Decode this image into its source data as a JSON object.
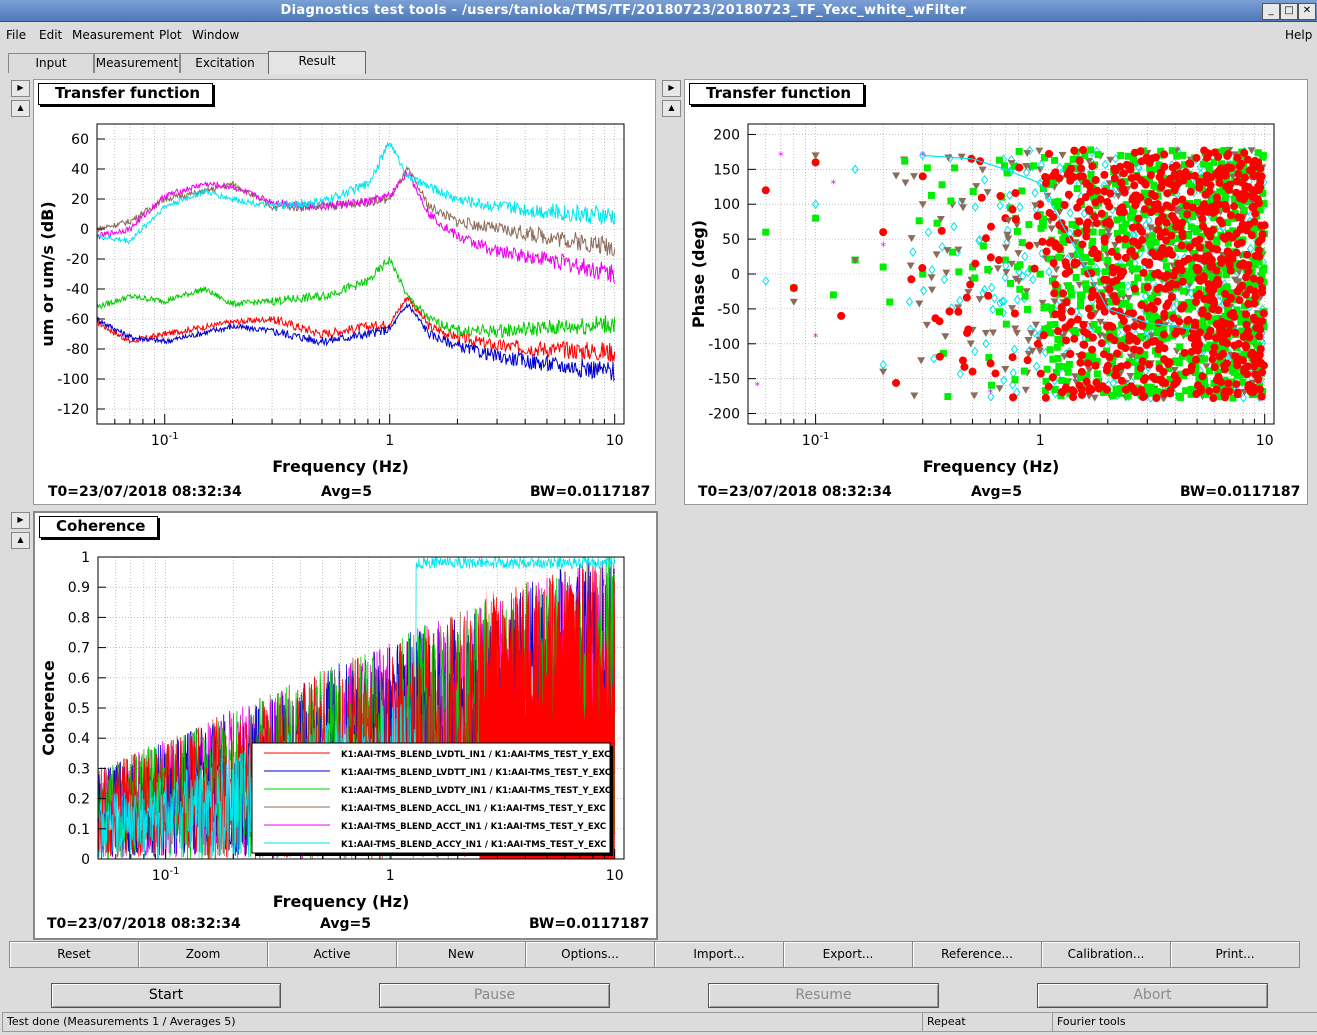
{
  "window": {
    "title": "Diagnostics test tools - /users/tanioka/TMS/TF/20180723/20180723_TF_Yexc_white_wFilter"
  },
  "menu": {
    "file": "File",
    "edit": "Edit",
    "measurement": "Measurement",
    "plot": "Plot",
    "window": "Window",
    "help": "Help"
  },
  "tabs": [
    "Input",
    "Measurement",
    "Excitation",
    "Result"
  ],
  "active_tab": "Result",
  "panels": {
    "tf_mag": {
      "title": "Transfer function",
      "t0": "T0=23/07/2018 08:32:34",
      "avg": "Avg=5",
      "bw": "BW=0.0117187"
    },
    "tf_phase": {
      "title": "Transfer function",
      "t0": "T0=23/07/2018 08:32:34",
      "avg": "Avg=5",
      "bw": "BW=0.0117187"
    },
    "coherence": {
      "title": "Coherence",
      "t0": "T0=23/07/2018 08:32:34",
      "avg": "Avg=5",
      "bw": "BW=0.0117187"
    }
  },
  "toolbar": [
    "Reset",
    "Zoom",
    "Active",
    "New",
    "Options...",
    "Import...",
    "Export...",
    "Reference...",
    "Calibration...",
    "Print..."
  ],
  "controls": {
    "start": "Start",
    "pause": "Pause",
    "resume": "Resume",
    "abort": "Abort"
  },
  "status": {
    "message": "Test done (Measurements 1 / Averages 5)",
    "repeat": "Repeat",
    "tools": "Fourier tools"
  },
  "colors": {
    "lvdtl": "#ff0000",
    "lvdtt": "#0000cc",
    "lvdty": "#00cc00",
    "accl": "#8b6b5a",
    "acct": "#ee00ee",
    "accy": "#00e5ee"
  },
  "chart_data": [
    {
      "type": "line",
      "title": "Transfer function",
      "xlabel": "Frequency (Hz)",
      "ylabel": "um or um/s (dB)",
      "xscale": "log",
      "xlim": [
        0.05,
        11
      ],
      "ylim": [
        -130,
        70
      ],
      "xticks": [
        "10^-1",
        "1",
        "10"
      ],
      "yticks": [
        60,
        40,
        20,
        0,
        -20,
        -40,
        -60,
        -80,
        -100,
        -120
      ],
      "grid": true,
      "series": [
        {
          "color": "#ff0000",
          "x": [
            0.05,
            0.07,
            0.1,
            0.2,
            0.3,
            0.5,
            0.8,
            1.0,
            1.2,
            1.5,
            2,
            3,
            5,
            10
          ],
          "y": [
            -62,
            -75,
            -70,
            -62,
            -60,
            -70,
            -65,
            -63,
            -45,
            -65,
            -72,
            -78,
            -80,
            -82
          ]
        },
        {
          "color": "#0000cc",
          "x": [
            0.05,
            0.07,
            0.1,
            0.2,
            0.3,
            0.5,
            0.8,
            1.0,
            1.2,
            1.5,
            2,
            3,
            5,
            10
          ],
          "y": [
            -60,
            -72,
            -75,
            -65,
            -68,
            -75,
            -70,
            -67,
            -50,
            -70,
            -78,
            -85,
            -90,
            -95
          ]
        },
        {
          "color": "#00cc00",
          "x": [
            0.05,
            0.07,
            0.1,
            0.15,
            0.2,
            0.3,
            0.5,
            0.8,
            1.0,
            1.2,
            1.5,
            2,
            3,
            5,
            10
          ],
          "y": [
            -52,
            -45,
            -48,
            -40,
            -50,
            -48,
            -45,
            -35,
            -20,
            -45,
            -60,
            -68,
            -68,
            -66,
            -63
          ]
        },
        {
          "color": "#8b6b5a",
          "x": [
            0.05,
            0.07,
            0.1,
            0.15,
            0.2,
            0.3,
            0.5,
            0.8,
            1.0,
            1.2,
            1.5,
            2,
            3,
            5,
            10
          ],
          "y": [
            0,
            5,
            20,
            25,
            30,
            15,
            15,
            18,
            20,
            40,
            15,
            5,
            0,
            -5,
            -12
          ]
        },
        {
          "color": "#ee00ee",
          "x": [
            0.05,
            0.07,
            0.1,
            0.15,
            0.2,
            0.3,
            0.5,
            0.8,
            1.0,
            1.2,
            1.5,
            2,
            3,
            5,
            10
          ],
          "y": [
            -5,
            0,
            22,
            30,
            28,
            18,
            15,
            18,
            22,
            38,
            10,
            -5,
            -15,
            -20,
            -30
          ]
        },
        {
          "color": "#00e5ee",
          "x": [
            0.05,
            0.07,
            0.1,
            0.15,
            0.2,
            0.3,
            0.5,
            0.8,
            1.0,
            1.2,
            1.5,
            2,
            3,
            5,
            10
          ],
          "y": [
            -5,
            -8,
            15,
            25,
            20,
            15,
            18,
            30,
            58,
            35,
            28,
            20,
            15,
            12,
            8
          ]
        }
      ]
    },
    {
      "type": "scatter",
      "title": "Transfer function",
      "xlabel": "Frequency (Hz)",
      "ylabel": "Phase (deg)",
      "xscale": "log",
      "xlim": [
        0.05,
        11
      ],
      "ylim": [
        -215,
        215
      ],
      "xticks": [
        "10^-1",
        "1",
        "10"
      ],
      "yticks": [
        200,
        150,
        100,
        50,
        0,
        -50,
        -100,
        -150,
        -200
      ],
      "grid": true,
      "series": [
        {
          "color": "#00ee00",
          "marker": "square",
          "x": [
            0.06,
            0.08,
            0.1,
            0.12,
            0.15,
            0.2,
            0.3,
            0.5,
            0.7,
            1.0
          ],
          "y": [
            60,
            -20,
            80,
            -30,
            20,
            10,
            0,
            10,
            20,
            0
          ]
        },
        {
          "color": "#ff0000",
          "marker": "circle",
          "x": [
            0.06,
            0.08,
            0.1,
            0.13,
            0.2,
            0.3,
            0.5,
            0.7,
            1.0
          ],
          "y": [
            120,
            -20,
            160,
            -60,
            60,
            140,
            -140,
            80,
            100
          ]
        },
        {
          "color": "#8b6b5a",
          "marker": "triangle",
          "x": [
            0.08,
            0.1,
            0.15,
            0.2,
            0.3,
            0.5,
            0.8,
            1.0
          ],
          "y": [
            -40,
            170,
            20,
            -140,
            100,
            -80,
            30,
            150
          ]
        },
        {
          "color": "#ee00ee",
          "marker": "star",
          "x": [
            0.055,
            0.07,
            0.1,
            0.12,
            0.2,
            0.3,
            0.6
          ],
          "y": [
            -160,
            170,
            -90,
            130,
            40,
            170,
            -170
          ]
        },
        {
          "color": "#00e5ee",
          "marker": "diamond",
          "x": [
            0.06,
            0.1,
            0.15,
            0.2,
            0.3,
            0.5,
            0.7,
            1.0,
            2,
            3,
            5
          ],
          "y": [
            -10,
            100,
            150,
            -130,
            170,
            165,
            150,
            130,
            -50,
            -70,
            -80
          ]
        }
      ]
    },
    {
      "type": "line",
      "title": "Coherence",
      "xlabel": "Frequency (Hz)",
      "ylabel": "Coherence",
      "xscale": "log",
      "xlim": [
        0.05,
        11
      ],
      "ylim": [
        0,
        1
      ],
      "xticks": [
        "10^-1",
        "1",
        "10"
      ],
      "yticks": [
        1,
        0.9,
        0.8,
        0.7,
        0.6,
        0.5,
        0.4,
        0.3,
        0.2,
        0.1,
        0
      ],
      "grid": true,
      "legend_position": "bottom-right",
      "series": [
        {
          "name": "K1:AAI-TMS_BLEND_LVDTL_IN1 / K1:AAI-TMS_TEST_Y_EXC",
          "color": "#ff0000"
        },
        {
          "name": "K1:AAI-TMS_BLEND_LVDTT_IN1 / K1:AAI-TMS_TEST_Y_EXC",
          "color": "#0000cc"
        },
        {
          "name": "K1:AAI-TMS_BLEND_LVDTY_IN1 / K1:AAI-TMS_TEST_Y_EXC",
          "color": "#00cc00"
        },
        {
          "name": "K1:AAI-TMS_BLEND_ACCL_IN1 / K1:AAI-TMS_TEST_Y_EXC",
          "color": "#8b6b5a"
        },
        {
          "name": "K1:AAI-TMS_BLEND_ACCT_IN1 / K1:AAI-TMS_TEST_Y_EXC",
          "color": "#ee00ee"
        },
        {
          "name": "K1:AAI-TMS_BLEND_ACCY_IN1 / K1:AAI-TMS_TEST_Y_EXC",
          "color": "#00e5ee"
        }
      ]
    }
  ]
}
